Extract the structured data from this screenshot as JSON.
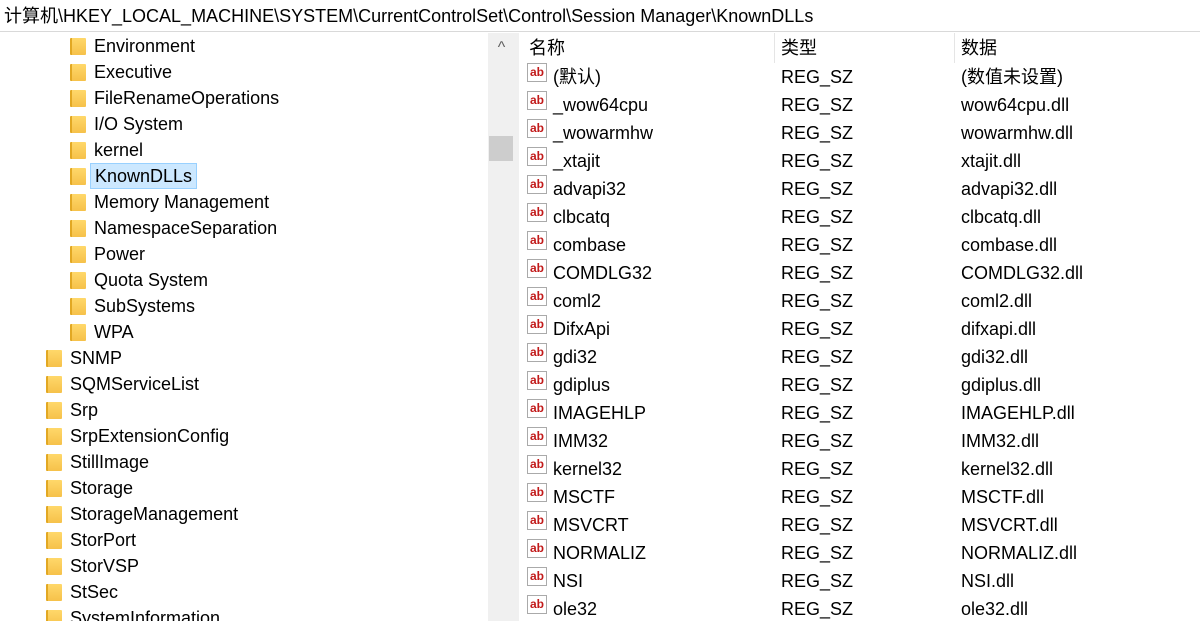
{
  "address": "计算机\\HKEY_LOCAL_MACHINE\\SYSTEM\\CurrentControlSet\\Control\\Session Manager\\KnownDLLs",
  "tree": {
    "children": [
      {
        "label": "Environment",
        "arrow": ""
      },
      {
        "label": "Executive",
        "arrow": ""
      },
      {
        "label": "FileRenameOperations",
        "arrow": ""
      },
      {
        "label": "I/O System",
        "arrow": ""
      },
      {
        "label": "kernel",
        "arrow": "›"
      },
      {
        "label": "KnownDLLs",
        "arrow": "",
        "selected": true
      },
      {
        "label": "Memory Management",
        "arrow": "›"
      },
      {
        "label": "NamespaceSeparation",
        "arrow": ""
      },
      {
        "label": "Power",
        "arrow": ""
      },
      {
        "label": "Quota System",
        "arrow": ""
      },
      {
        "label": "SubSystems",
        "arrow": ""
      },
      {
        "label": "WPA",
        "arrow": "›"
      }
    ],
    "siblings": [
      {
        "label": "SNMP",
        "arrow": "›"
      },
      {
        "label": "SQMServiceList",
        "arrow": ""
      },
      {
        "label": "Srp",
        "arrow": "›"
      },
      {
        "label": "SrpExtensionConfig",
        "arrow": ""
      },
      {
        "label": "StillImage",
        "arrow": "›"
      },
      {
        "label": "Storage",
        "arrow": "›"
      },
      {
        "label": "StorageManagement",
        "arrow": "›"
      },
      {
        "label": "StorPort",
        "arrow": ""
      },
      {
        "label": "StorVSP",
        "arrow": "›"
      },
      {
        "label": "StSec",
        "arrow": "›"
      },
      {
        "label": "SystemInformation",
        "arrow": ""
      }
    ]
  },
  "scrollbar": {
    "up_glyph": "^"
  },
  "list": {
    "headers": {
      "name": "名称",
      "type": "类型",
      "data": "数据"
    },
    "value_icon": "ab",
    "rows": [
      {
        "name": "(默认)",
        "type": "REG_SZ",
        "data": "(数值未设置)"
      },
      {
        "name": "_wow64cpu",
        "type": "REG_SZ",
        "data": "wow64cpu.dll"
      },
      {
        "name": "_wowarmhw",
        "type": "REG_SZ",
        "data": "wowarmhw.dll"
      },
      {
        "name": "_xtajit",
        "type": "REG_SZ",
        "data": "xtajit.dll"
      },
      {
        "name": "advapi32",
        "type": "REG_SZ",
        "data": "advapi32.dll"
      },
      {
        "name": "clbcatq",
        "type": "REG_SZ",
        "data": "clbcatq.dll"
      },
      {
        "name": "combase",
        "type": "REG_SZ",
        "data": "combase.dll"
      },
      {
        "name": "COMDLG32",
        "type": "REG_SZ",
        "data": "COMDLG32.dll"
      },
      {
        "name": "coml2",
        "type": "REG_SZ",
        "data": "coml2.dll"
      },
      {
        "name": "DifxApi",
        "type": "REG_SZ",
        "data": "difxapi.dll"
      },
      {
        "name": "gdi32",
        "type": "REG_SZ",
        "data": "gdi32.dll"
      },
      {
        "name": "gdiplus",
        "type": "REG_SZ",
        "data": "gdiplus.dll"
      },
      {
        "name": "IMAGEHLP",
        "type": "REG_SZ",
        "data": "IMAGEHLP.dll"
      },
      {
        "name": "IMM32",
        "type": "REG_SZ",
        "data": "IMM32.dll"
      },
      {
        "name": "kernel32",
        "type": "REG_SZ",
        "data": "kernel32.dll"
      },
      {
        "name": "MSCTF",
        "type": "REG_SZ",
        "data": "MSCTF.dll"
      },
      {
        "name": "MSVCRT",
        "type": "REG_SZ",
        "data": "MSVCRT.dll"
      },
      {
        "name": "NORMALIZ",
        "type": "REG_SZ",
        "data": "NORMALIZ.dll"
      },
      {
        "name": "NSI",
        "type": "REG_SZ",
        "data": "NSI.dll"
      },
      {
        "name": "ole32",
        "type": "REG_SZ",
        "data": "ole32.dll"
      }
    ]
  }
}
